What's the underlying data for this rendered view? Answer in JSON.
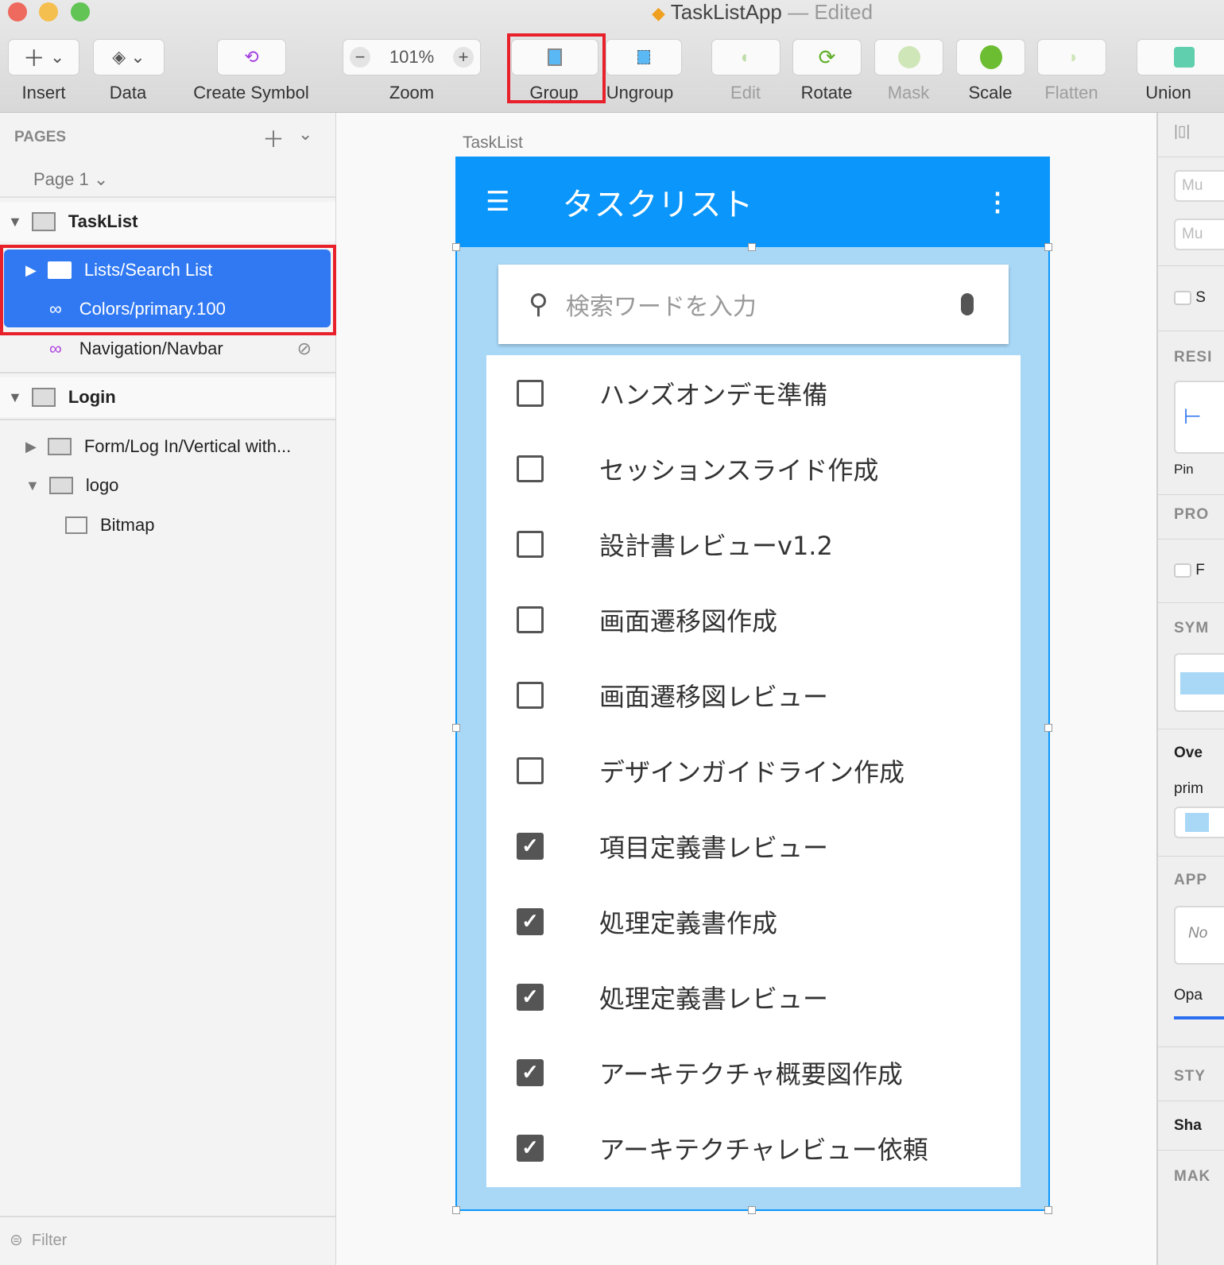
{
  "window": {
    "title": "TaskListApp",
    "status": "— Edited"
  },
  "toolbar": {
    "insert": "Insert",
    "data": "Data",
    "create_symbol": "Create Symbol",
    "zoom": "Zoom",
    "zoom_value": "101%",
    "group": "Group",
    "ungroup": "Ungroup",
    "edit": "Edit",
    "rotate": "Rotate",
    "mask": "Mask",
    "scale": "Scale",
    "flatten": "Flatten",
    "union": "Union"
  },
  "left": {
    "pages_header": "PAGES",
    "page": "Page 1",
    "filter": "Filter",
    "layers": {
      "tasklist": "TaskList",
      "search_list": "Lists/Search List",
      "colors": "Colors/primary.100",
      "navbar": "Navigation/Navbar",
      "login": "Login",
      "form": "Form/Log In/Vertical with...",
      "logo": "logo",
      "bitmap": "Bitmap"
    }
  },
  "canvas": {
    "artboard_label": "TaskList",
    "app_title": "タスクリスト",
    "search_placeholder": "検索ワードを入力",
    "tasks": [
      {
        "label": "ハンズオンデモ準備",
        "done": false
      },
      {
        "label": "セッションスライド作成",
        "done": false
      },
      {
        "label": "設計書レビューv1.2",
        "done": false
      },
      {
        "label": "画面遷移図作成",
        "done": false
      },
      {
        "label": "画面遷移図レビュー",
        "done": false
      },
      {
        "label": "デザインガイドライン作成",
        "done": false
      },
      {
        "label": "項目定義書レビュー",
        "done": true
      },
      {
        "label": "処理定義書作成",
        "done": true
      },
      {
        "label": "処理定義書レビュー",
        "done": true
      },
      {
        "label": "アーキテクチャ概要図作成",
        "done": true
      },
      {
        "label": "アーキテクチャレビュー依頼",
        "done": true
      }
    ],
    "colors": {
      "appbar": "#0a96fa",
      "overlay": "#a9d8f7",
      "selection": "#3179f3"
    }
  },
  "right": {
    "mu1": "Mu",
    "mu2": "Mu",
    "s": "S",
    "resizing": "RESI",
    "pin": "Pin",
    "prototyping": "PRO",
    "f": "F",
    "symbol": "SYM",
    "overrides": "Ove",
    "primary": "prim",
    "appearance": "APP",
    "none": "No",
    "opacity": "Opa",
    "style": "STY",
    "shadows": "Sha",
    "make": "MAK"
  }
}
